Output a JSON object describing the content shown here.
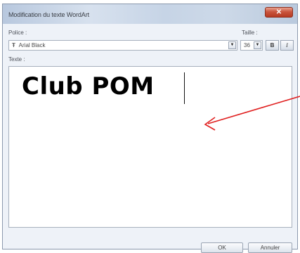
{
  "window": {
    "title": "Modification du texte WordArt",
    "close_glyph": "✕"
  },
  "labels": {
    "police": "Police :",
    "taille": "Taille :",
    "texte": "Texte :"
  },
  "font": {
    "icon": "truetype-font-icon",
    "icon_glyph": "Ŧ",
    "value": "Arial Black"
  },
  "size": {
    "value": "36"
  },
  "format": {
    "bold": "B",
    "italic": "I"
  },
  "editor": {
    "text": "Club POM"
  },
  "buttons": {
    "ok": "OK",
    "cancel": "Annuler"
  },
  "annotation": {
    "arrow_color": "#e02020"
  }
}
